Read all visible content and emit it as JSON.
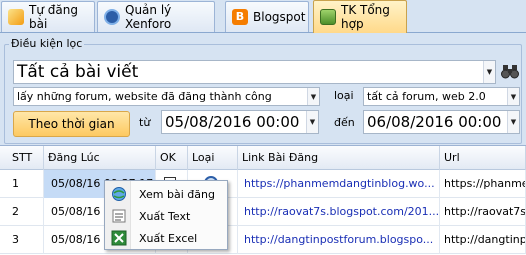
{
  "tabs": [
    {
      "label": "Tự đăng bài",
      "icon": "wand-icon"
    },
    {
      "label": "Quản lý Xenforo",
      "icon": "xenforo-icon"
    },
    {
      "label": "Blogspot",
      "icon": "blogger-icon"
    },
    {
      "label": "TK Tổng hợp",
      "icon": "stats-icon"
    }
  ],
  "filter": {
    "group_label": "Điều kiện lọc",
    "post_scope": "Tất cả bài viết",
    "forum_condition": "lấy những forum, website đã đăng thành công",
    "type_label": "loại",
    "type_value": "tất cả forum, web 2.0",
    "time_button": "Theo thời gian",
    "from_label": "từ",
    "from_value": "05/08/2016 00:00",
    "to_label": "đến",
    "to_value": "06/08/2016 00:00"
  },
  "grid": {
    "columns": [
      "STT",
      "Đăng Lúc",
      "OK",
      "Loại",
      "Link Bài Đăng",
      "Url"
    ],
    "rows": [
      {
        "stt": "1",
        "time": "05/08/16 09:37:17",
        "link": "https://phanmemdangtinblog.wo...",
        "url": "https://phanmem"
      },
      {
        "stt": "2",
        "time": "05/08/16 09:39:47",
        "link": "http://raovat7s.blogspot.com/201...",
        "url": "http://raovat7s."
      },
      {
        "stt": "3",
        "time": "05/08/16 09:41:15",
        "link": "http://dangtinpostforum.blogspo...",
        "url": "http://dangtinp"
      }
    ]
  },
  "context_menu": [
    {
      "label": "Xem bài đăng",
      "icon": "globe-view-icon"
    },
    {
      "label": "Xuất Text",
      "icon": "text-export-icon"
    },
    {
      "label": "Xuất Excel",
      "icon": "excel-icon"
    }
  ],
  "colors": {
    "active_tab": "#ffd98a",
    "button": "#fdc961",
    "link": "#1a2fb5",
    "selection": "#c5dbf6"
  }
}
